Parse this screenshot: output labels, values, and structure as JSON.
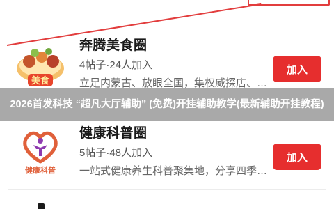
{
  "circles": [
    {
      "title": "奔腾美食圈",
      "meta": "4帖子·24人加入",
      "desc": "立足内蒙古、放眼全国，集权威探店、地方美食推荐",
      "join_label": "加入",
      "logo_text": "美食",
      "logo_icon": "food-platter-icon"
    },
    {
      "title": "健康科普圈",
      "meta": "5帖子·48人加入",
      "desc": "一站式健康养生科普聚集地，分享四季养生知识",
      "join_label": "加入",
      "logo_text": "健康科普",
      "logo_icon": "heart-person-icon"
    }
  ],
  "overlay_banner": "2026首发科技 “超凡大厅辅助” (免费)开挂辅助教学(最新辅助开挂教程)",
  "colors": {
    "accent": "#e62e2e",
    "annotation": "#e23d3d",
    "overlay": "#969696",
    "health_logo": "#e0603a",
    "health_person": "#8e3bb0"
  }
}
